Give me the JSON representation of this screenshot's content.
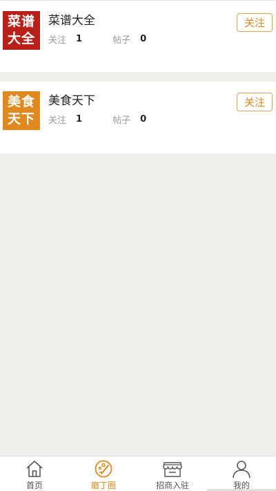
{
  "forums": [
    {
      "logo_line1": "菜谱",
      "logo_line2": "大全",
      "logo_color": "#b8211a",
      "name": "菜谱大全",
      "follow_label": "关注",
      "follow_count": "1",
      "posts_label": "帖子",
      "posts_count": "0",
      "follow_button": "关注"
    },
    {
      "logo_line1": "美食",
      "logo_line2": "天下",
      "logo_color": "#e0891e",
      "name": "美食天下",
      "follow_label": "关注",
      "follow_count": "1",
      "posts_label": "帖子",
      "posts_count": "0",
      "follow_button": "关注"
    }
  ],
  "tabbar": {
    "active_color": "#d98a1c",
    "tabs": [
      {
        "label": "首页",
        "icon": "home-icon"
      },
      {
        "label": "磨丁圈",
        "icon": "palette-icon",
        "active": true
      },
      {
        "label": "招商入驻",
        "icon": "storefront-icon"
      },
      {
        "label": "我的",
        "icon": "user-icon"
      }
    ]
  }
}
